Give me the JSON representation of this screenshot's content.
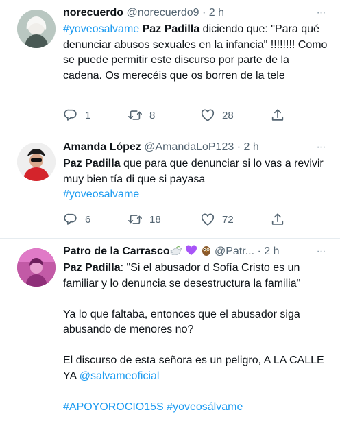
{
  "tweets": [
    {
      "display_name": "norecuerdo",
      "handle": "@norecuerdo9",
      "separator": "·",
      "time": "2 h",
      "more_label": "···",
      "hashtag_1": "#yoveosalvame",
      "bold_1": "Paz Padilla",
      "text_1": " diciendo que: \"Para qué denunciar abusos sexuales en la infancia\" !!!!!!!! Como se puede permitir este discurso por parte de la cadena. Os merecéis que os borren de la tele",
      "replies": "1",
      "retweets": "8",
      "likes": "28"
    },
    {
      "display_name": "Amanda López",
      "handle": "@AmandaLoP123",
      "separator": "·",
      "time": "2 h",
      "more_label": "···",
      "bold_1": "Paz Padilla",
      "text_1": " que para que denunciar si lo vas a revivir muy bien tía di que si payasa",
      "hashtag_1": "#yoveosalvame",
      "replies": "6",
      "retweets": "18",
      "likes": "72"
    },
    {
      "display_name": "Patro de la Carrasco",
      "handle": "@Patr...",
      "separator": "·",
      "time": "2 h",
      "more_label": "···",
      "bold_1": "Paz Padilla",
      "text_1": ": \"Si el abusador d Sofía Cristo es un familiar y lo denuncia se desestructura la familia\"",
      "text_2": "Ya lo que faltaba, entonces que el abusador siga abusando de menores no?",
      "text_3": "El discurso de esta señora es un peligro, A LA CALLE YA ",
      "mention_1": "@salvameoficial",
      "hashtag_1": "#APOYOROCIO15S",
      "hashtag_2": "#yoveosálvame"
    }
  ],
  "icons": {
    "reply": "reply-icon",
    "retweet": "retweet-icon",
    "like": "heart-icon",
    "share": "share-icon",
    "emoji_1": "dove-emoji",
    "emoji_2": "purple-heart-emoji",
    "emoji_3": "owl-emoji"
  },
  "colors": {
    "link": "#1d9bf0",
    "secondary_text": "#536471",
    "divider": "#e6ecf0",
    "heart_emoji": "#a855f7"
  }
}
